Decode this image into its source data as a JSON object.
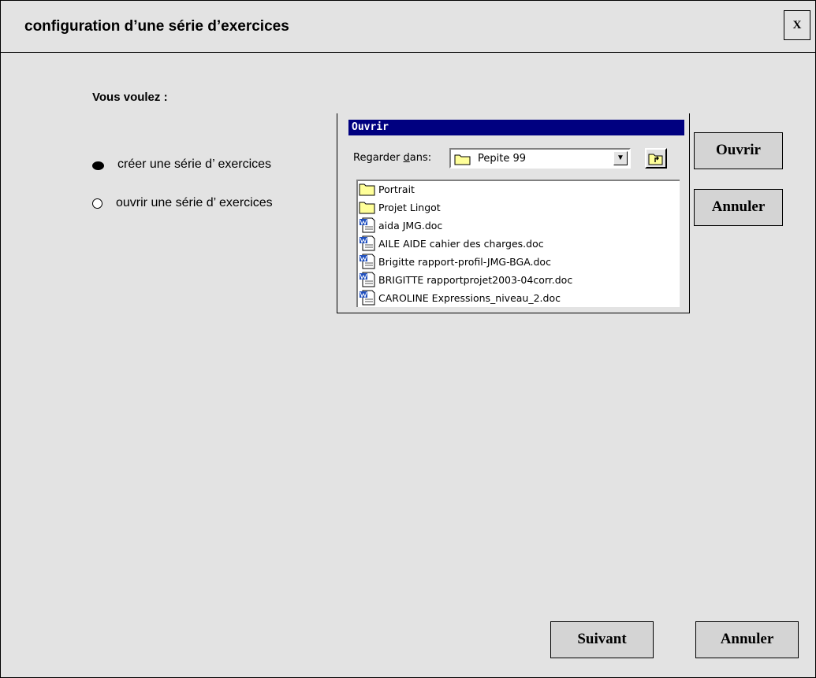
{
  "window": {
    "title": "configuration d’une série d’exercices",
    "close_label": "X"
  },
  "form": {
    "prompt": "Vous voulez :",
    "options": [
      {
        "label": "créer une série d’ exercices",
        "selected": true
      },
      {
        "label": "ouvrir une série d’ exercices",
        "selected": false
      }
    ]
  },
  "open_dialog": {
    "title": "Ouvrir",
    "look_in_label_pre": "Regarder ",
    "look_in_label_accel": "d",
    "look_in_label_post": "ans:",
    "look_in_value": "Pepite 99",
    "look_in_icon": "folder-icon",
    "up_icon": "up-folder-icon",
    "files": [
      {
        "name": "Portrait",
        "icon": "folder-icon"
      },
      {
        "name": "Projet Lingot",
        "icon": "folder-icon"
      },
      {
        "name": "aida JMG.doc",
        "icon": "word-doc-icon"
      },
      {
        "name": "AILE AIDE cahier des charges.doc",
        "icon": "word-doc-icon"
      },
      {
        "name": "Brigitte rapport-profil-JMG-BGA.doc",
        "icon": "word-doc-icon"
      },
      {
        "name": "BRIGITTE rapportprojet2003-04corr.doc",
        "icon": "word-doc-icon"
      },
      {
        "name": "CAROLINE Expressions_niveau_2.doc",
        "icon": "word-doc-icon"
      }
    ],
    "open_button": "Ouvrir",
    "cancel_button": "Annuler"
  },
  "footer": {
    "next_button": "Suivant",
    "cancel_button": "Annuler"
  },
  "colors": {
    "background": "#e3e3e3",
    "dialog_title_bar": "#000080",
    "folder_fill": "#ffff99"
  }
}
